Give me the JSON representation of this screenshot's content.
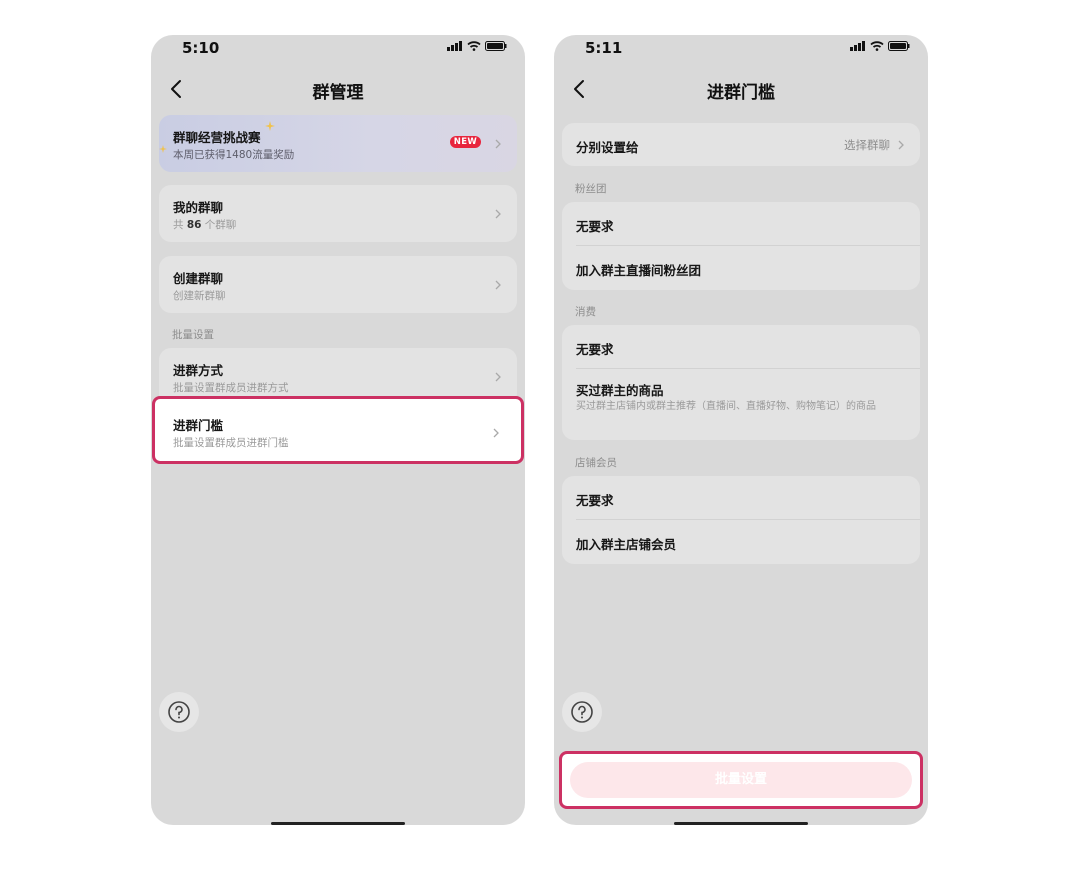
{
  "left": {
    "time": "5:10",
    "title": "群管理",
    "banner": {
      "title": "群聊经营挑战赛",
      "subtitle": "本周已获得1480流量奖励",
      "badge": "NEW"
    },
    "my_groups": {
      "title": "我的群聊",
      "prefix": "共 ",
      "count": "86",
      "suffix": " 个群聊"
    },
    "create_group": {
      "title": "创建群聊",
      "subtitle": "创建新群聊"
    },
    "section_label": "批量设置",
    "join_method": {
      "title": "进群方式",
      "subtitle": "批量设置群成员进群方式"
    },
    "join_threshold": {
      "title": "进群门槛",
      "subtitle": "批量设置群成员进群门槛"
    }
  },
  "right": {
    "time": "5:11",
    "title": "进群门槛",
    "set_separately": {
      "label": "分别设置给",
      "value": "选择群聊"
    },
    "fans_section": {
      "label": "粉丝团",
      "options": [
        "无要求",
        "加入群主直播间粉丝团"
      ]
    },
    "purchase_section": {
      "label": "消费",
      "option_none": "无要求",
      "option_bought": "买过群主的商品",
      "option_bought_desc": "买过群主店铺内或群主推荐（直播间、直播好物、购物笔记）的商品"
    },
    "member_section": {
      "label": "店铺会员",
      "options": [
        "无要求",
        "加入群主店铺会员"
      ]
    },
    "batch_button": "批量设置"
  },
  "colors": {
    "highlight": "#cc3163",
    "badge": "#e8253d",
    "background": "#d9d9d9"
  }
}
